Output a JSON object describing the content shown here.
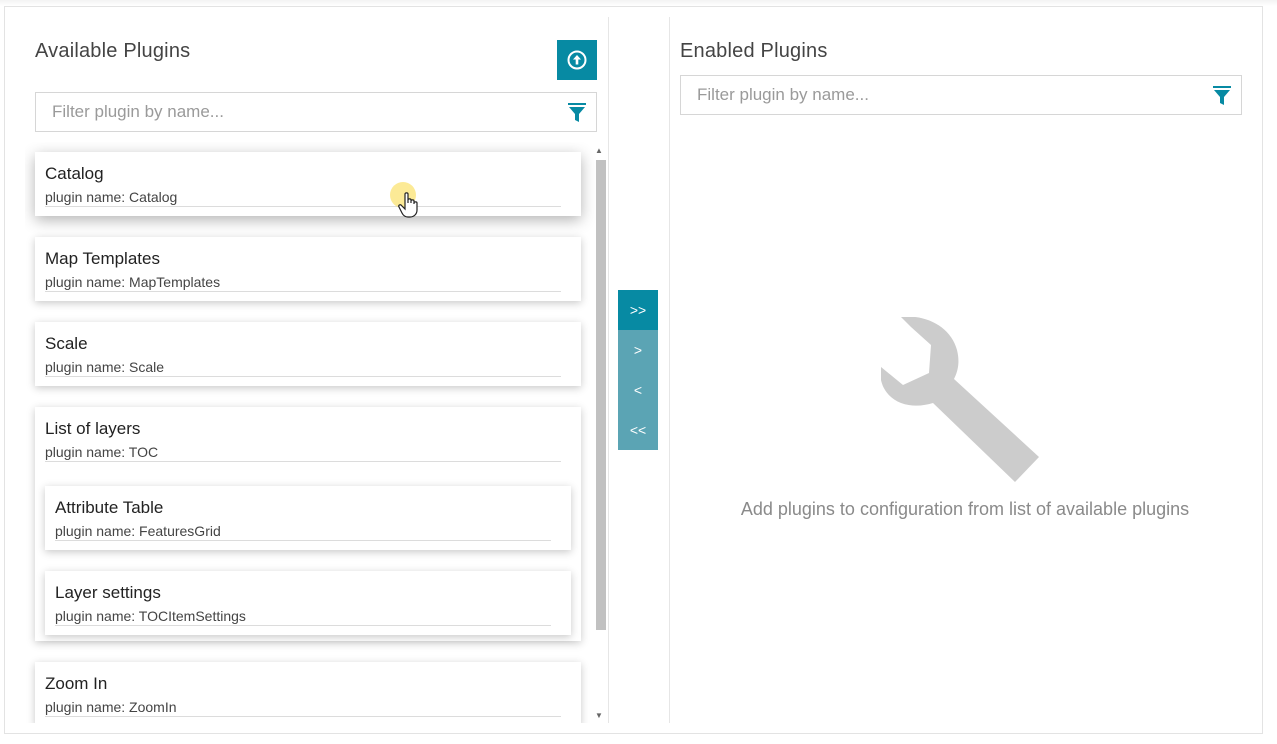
{
  "available": {
    "title": "Available Plugins",
    "filter_placeholder": "Filter plugin by name...",
    "upload_icon": "upload-circle-icon",
    "plugins": [
      {
        "title": "Catalog",
        "subtitle": "plugin name: Catalog"
      },
      {
        "title": "Map Templates",
        "subtitle": "plugin name: MapTemplates"
      },
      {
        "title": "Scale",
        "subtitle": "plugin name: Scale"
      },
      {
        "title": "List of layers",
        "subtitle": "plugin name: TOC",
        "children": [
          {
            "title": "Attribute Table",
            "subtitle": "plugin name: FeaturesGrid"
          },
          {
            "title": "Layer settings",
            "subtitle": "plugin name: TOCItemSettings"
          }
        ]
      },
      {
        "title": "Zoom In",
        "subtitle": "plugin name: ZoomIn"
      }
    ]
  },
  "transfer": {
    "move_all_right": ">>",
    "move_right": ">",
    "move_left": "<",
    "move_all_left": "<<"
  },
  "enabled": {
    "title": "Enabled Plugins",
    "filter_placeholder": "Filter plugin by name...",
    "empty_icon": "wrench-icon",
    "empty_message": "Add plugins to configuration from list of available plugins"
  },
  "colors": {
    "accent": "#078aa3",
    "accent_muted": "#5ba4b4",
    "empty_icon": "#cccccc"
  }
}
